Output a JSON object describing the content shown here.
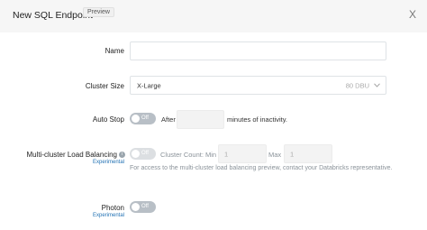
{
  "header": {
    "title": "New SQL Endpoint",
    "badge": "Preview",
    "close": "X"
  },
  "name": {
    "label": "Name",
    "value": ""
  },
  "cluster_size": {
    "label": "Cluster Size",
    "value": "X-Large",
    "dbu": "80 DBU"
  },
  "auto_stop": {
    "label": "Auto Stop",
    "toggle": "Off",
    "after": "After",
    "minutes_value": "",
    "suffix": "minutes of inactivity."
  },
  "load_balancing": {
    "label": "Multi-cluster Load Balancing",
    "experimental": "Experimental",
    "toggle": "Off",
    "cluster_count_label": "Cluster Count: Min",
    "min_value": "1",
    "max_label": "Max",
    "max_value": "1",
    "help": "For access to the multi-cluster load balancing preview, contact your Databricks representative."
  },
  "photon": {
    "label": "Photon",
    "experimental": "Experimental",
    "toggle": "Off"
  }
}
